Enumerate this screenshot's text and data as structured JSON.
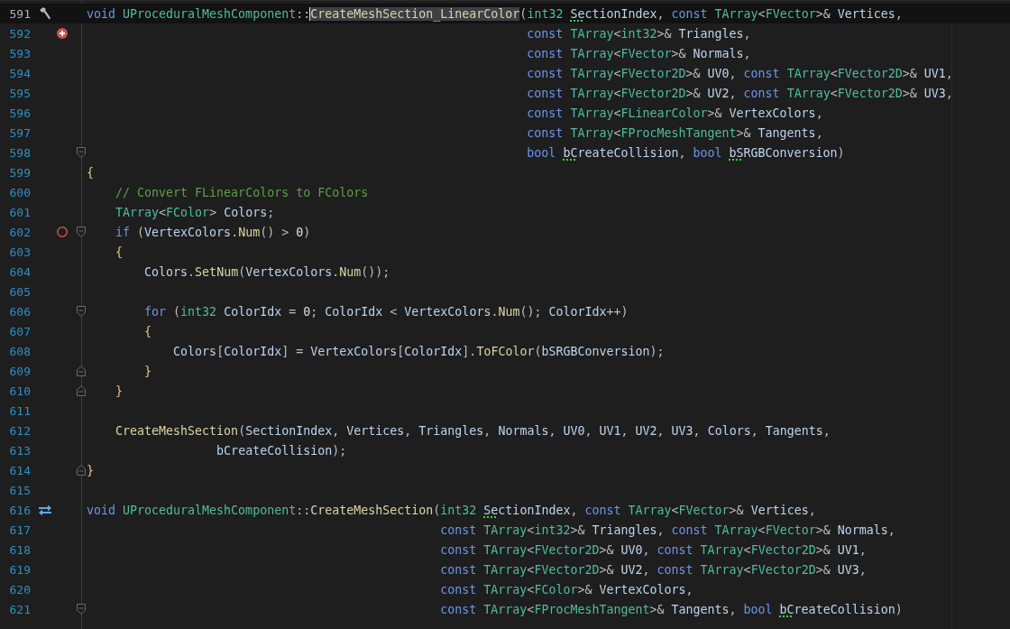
{
  "lines": [
    {
      "number": "591",
      "current": true,
      "kind": "build",
      "tokens": [
        {
          "kind": "keyword",
          "text": "void "
        },
        {
          "kind": "type",
          "text": "UProceduralMeshComponent"
        },
        {
          "kind": "punct",
          "text": "::"
        },
        {
          "kind": "selected",
          "text": "CreateMeshSection_LinearColor"
        },
        {
          "kind": "punct",
          "text": "("
        },
        {
          "kind": "type",
          "text": "int32 "
        },
        {
          "kind": "hint",
          "text": "Se"
        },
        {
          "kind": "variable",
          "text": "ctionIndex"
        },
        {
          "kind": "punct",
          "text": ", "
        },
        {
          "kind": "keyword",
          "text": "const "
        },
        {
          "kind": "type",
          "text": "TArray"
        },
        {
          "kind": "punct",
          "text": "<"
        },
        {
          "kind": "type",
          "text": "FVector"
        },
        {
          "kind": "punct",
          "text": ">& "
        },
        {
          "kind": "variable",
          "text": "Vertices"
        },
        {
          "kind": "punct",
          "text": ","
        }
      ]
    },
    {
      "number": "592",
      "current": false,
      "kind": "add",
      "tokens": [
        {
          "kind": "keyword",
          "text": "                                                             const "
        },
        {
          "kind": "type",
          "text": "TArray"
        },
        {
          "kind": "punct",
          "text": "<"
        },
        {
          "kind": "type",
          "text": "int32"
        },
        {
          "kind": "punct",
          "text": ">& "
        },
        {
          "kind": "variable",
          "text": "Triangles"
        },
        {
          "kind": "punct",
          "text": ","
        }
      ]
    },
    {
      "number": "593",
      "current": false,
      "kind": "plain",
      "tokens": [
        {
          "kind": "keyword",
          "text": "                                                             const "
        },
        {
          "kind": "type",
          "text": "TArray"
        },
        {
          "kind": "punct",
          "text": "<"
        },
        {
          "kind": "type",
          "text": "FVector"
        },
        {
          "kind": "punct",
          "text": ">& "
        },
        {
          "kind": "variable",
          "text": "Normals"
        },
        {
          "kind": "punct",
          "text": ","
        }
      ]
    },
    {
      "number": "594",
      "current": false,
      "kind": "plain",
      "tokens": [
        {
          "kind": "keyword",
          "text": "                                                             const "
        },
        {
          "kind": "type",
          "text": "TArray"
        },
        {
          "kind": "punct",
          "text": "<"
        },
        {
          "kind": "type",
          "text": "FVector2D"
        },
        {
          "kind": "punct",
          "text": ">& "
        },
        {
          "kind": "variable",
          "text": "UV0"
        },
        {
          "kind": "punct",
          "text": ", "
        },
        {
          "kind": "keyword",
          "text": "const "
        },
        {
          "kind": "type",
          "text": "TArray"
        },
        {
          "kind": "punct",
          "text": "<"
        },
        {
          "kind": "type",
          "text": "FVector2D"
        },
        {
          "kind": "punct",
          "text": ">& "
        },
        {
          "kind": "variable",
          "text": "UV1"
        },
        {
          "kind": "punct",
          "text": ","
        }
      ]
    },
    {
      "number": "595",
      "current": false,
      "kind": "plain",
      "tokens": [
        {
          "kind": "keyword",
          "text": "                                                             const "
        },
        {
          "kind": "type",
          "text": "TArray"
        },
        {
          "kind": "punct",
          "text": "<"
        },
        {
          "kind": "type",
          "text": "FVector2D"
        },
        {
          "kind": "punct",
          "text": ">& "
        },
        {
          "kind": "variable",
          "text": "UV2"
        },
        {
          "kind": "punct",
          "text": ", "
        },
        {
          "kind": "keyword",
          "text": "const "
        },
        {
          "kind": "type",
          "text": "TArray"
        },
        {
          "kind": "punct",
          "text": "<"
        },
        {
          "kind": "type",
          "text": "FVector2D"
        },
        {
          "kind": "punct",
          "text": ">& "
        },
        {
          "kind": "variable",
          "text": "UV3"
        },
        {
          "kind": "punct",
          "text": ","
        }
      ]
    },
    {
      "number": "596",
      "current": false,
      "kind": "plain",
      "tokens": [
        {
          "kind": "keyword",
          "text": "                                                             const "
        },
        {
          "kind": "type",
          "text": "TArray"
        },
        {
          "kind": "punct",
          "text": "<"
        },
        {
          "kind": "type",
          "text": "FLinearColor"
        },
        {
          "kind": "punct",
          "text": ">& "
        },
        {
          "kind": "variable",
          "text": "VertexColors"
        },
        {
          "kind": "punct",
          "text": ","
        }
      ]
    },
    {
      "number": "597",
      "current": false,
      "kind": "plain",
      "tokens": [
        {
          "kind": "keyword",
          "text": "                                                             const "
        },
        {
          "kind": "type",
          "text": "TArray"
        },
        {
          "kind": "punct",
          "text": "<"
        },
        {
          "kind": "type",
          "text": "FProcMeshTangent"
        },
        {
          "kind": "punct",
          "text": ">& "
        },
        {
          "kind": "variable",
          "text": "Tangents"
        },
        {
          "kind": "punct",
          "text": ","
        }
      ]
    },
    {
      "number": "598",
      "current": false,
      "kind": "plain",
      "fold": {
        "kind": "start"
      },
      "tokens": [
        {
          "kind": "keyword",
          "text": "                                                             bool "
        },
        {
          "kind": "hint",
          "text": "bC"
        },
        {
          "kind": "variable",
          "text": "reateCollision"
        },
        {
          "kind": "punct",
          "text": ", "
        },
        {
          "kind": "keyword",
          "text": "bool "
        },
        {
          "kind": "hint",
          "text": "bS"
        },
        {
          "kind": "variable",
          "text": "RGBConversion"
        },
        {
          "kind": "punct",
          "text": ")"
        }
      ]
    },
    {
      "number": "599",
      "current": false,
      "kind": "plain",
      "tokens": [
        {
          "kind": "brace",
          "text": "{"
        }
      ]
    },
    {
      "number": "600",
      "current": false,
      "kind": "plain",
      "tokens": [
        {
          "kind": "comment",
          "text": "    // Convert FLinearColors to FColors"
        }
      ]
    },
    {
      "number": "601",
      "current": false,
      "kind": "plain",
      "tokens": [
        {
          "kind": "type",
          "text": "    TArray"
        },
        {
          "kind": "punct",
          "text": "<"
        },
        {
          "kind": "type",
          "text": "FColor"
        },
        {
          "kind": "punct",
          "text": "> "
        },
        {
          "kind": "variable",
          "text": "Colors"
        },
        {
          "kind": "punct",
          "text": ";"
        }
      ]
    },
    {
      "number": "602",
      "current": false,
      "kind": "breakpoint",
      "fold": {
        "kind": "start"
      },
      "tokens": [
        {
          "kind": "keyword",
          "text": "    if"
        },
        {
          "kind": "punct",
          "text": " ("
        },
        {
          "kind": "variable",
          "text": "VertexColors"
        },
        {
          "kind": "punct",
          "text": "."
        },
        {
          "kind": "function",
          "text": "Num"
        },
        {
          "kind": "punct",
          "text": "() > "
        },
        {
          "kind": "number",
          "text": "0"
        },
        {
          "kind": "punct",
          "text": ")"
        }
      ]
    },
    {
      "number": "603",
      "current": false,
      "kind": "plain",
      "tokens": [
        {
          "kind": "brace",
          "text": "    {"
        }
      ]
    },
    {
      "number": "604",
      "current": false,
      "kind": "plain",
      "tokens": [
        {
          "kind": "variable",
          "text": "        Colors"
        },
        {
          "kind": "punct",
          "text": "."
        },
        {
          "kind": "function",
          "text": "SetNum"
        },
        {
          "kind": "punct",
          "text": "("
        },
        {
          "kind": "variable",
          "text": "VertexColors"
        },
        {
          "kind": "punct",
          "text": "."
        },
        {
          "kind": "function",
          "text": "Num"
        },
        {
          "kind": "punct",
          "text": "());"
        }
      ]
    },
    {
      "number": "605",
      "current": false,
      "kind": "plain"
    },
    {
      "number": "606",
      "current": false,
      "kind": "plain",
      "fold": {
        "kind": "start"
      },
      "tokens": [
        {
          "kind": "keyword",
          "text": "        for"
        },
        {
          "kind": "punct",
          "text": " ("
        },
        {
          "kind": "type",
          "text": "int32 "
        },
        {
          "kind": "variable",
          "text": "ColorIdx"
        },
        {
          "kind": "punct",
          "text": " = "
        },
        {
          "kind": "number",
          "text": "0"
        },
        {
          "kind": "punct",
          "text": "; "
        },
        {
          "kind": "variable",
          "text": "ColorIdx"
        },
        {
          "kind": "punct",
          "text": " < "
        },
        {
          "kind": "variable",
          "text": "VertexColors"
        },
        {
          "kind": "punct",
          "text": "."
        },
        {
          "kind": "function",
          "text": "Num"
        },
        {
          "kind": "punct",
          "text": "(); "
        },
        {
          "kind": "variable",
          "text": "ColorIdx"
        },
        {
          "kind": "punct",
          "text": "++)"
        }
      ]
    },
    {
      "number": "607",
      "current": false,
      "kind": "plain",
      "tokens": [
        {
          "kind": "brace",
          "text": "        {"
        }
      ]
    },
    {
      "number": "608",
      "current": false,
      "kind": "plain",
      "tokens": [
        {
          "kind": "variable",
          "text": "            Colors"
        },
        {
          "kind": "punct",
          "text": "["
        },
        {
          "kind": "variable",
          "text": "ColorIdx"
        },
        {
          "kind": "punct",
          "text": "] = "
        },
        {
          "kind": "variable",
          "text": "VertexColors"
        },
        {
          "kind": "punct",
          "text": "["
        },
        {
          "kind": "variable",
          "text": "ColorIdx"
        },
        {
          "kind": "punct",
          "text": "]."
        },
        {
          "kind": "function",
          "text": "ToFColor"
        },
        {
          "kind": "punct",
          "text": "("
        },
        {
          "kind": "variable",
          "text": "bSRGBConversion"
        },
        {
          "kind": "punct",
          "text": ");"
        }
      ]
    },
    {
      "number": "609",
      "current": false,
      "kind": "plain",
      "fold": {
        "kind": "end"
      },
      "tokens": [
        {
          "kind": "brace",
          "text": "        }"
        }
      ]
    },
    {
      "number": "610",
      "current": false,
      "kind": "plain",
      "fold": {
        "kind": "end"
      },
      "tokens": [
        {
          "kind": "brace",
          "text": "    }"
        }
      ]
    },
    {
      "number": "611",
      "current": false,
      "kind": "plain"
    },
    {
      "number": "612",
      "current": false,
      "kind": "plain",
      "tokens": [
        {
          "kind": "function",
          "text": "    CreateMeshSection"
        },
        {
          "kind": "punct",
          "text": "("
        },
        {
          "kind": "variable",
          "text": "SectionIndex"
        },
        {
          "kind": "punct",
          "text": ", "
        },
        {
          "kind": "variable",
          "text": "Vertices"
        },
        {
          "kind": "punct",
          "text": ", "
        },
        {
          "kind": "variable",
          "text": "Triangles"
        },
        {
          "kind": "punct",
          "text": ", "
        },
        {
          "kind": "variable",
          "text": "Normals"
        },
        {
          "kind": "punct",
          "text": ", "
        },
        {
          "kind": "variable",
          "text": "UV0"
        },
        {
          "kind": "punct",
          "text": ", "
        },
        {
          "kind": "variable",
          "text": "UV1"
        },
        {
          "kind": "punct",
          "text": ", "
        },
        {
          "kind": "variable",
          "text": "UV2"
        },
        {
          "kind": "punct",
          "text": ", "
        },
        {
          "kind": "variable",
          "text": "UV3"
        },
        {
          "kind": "punct",
          "text": ", "
        },
        {
          "kind": "variable",
          "text": "Colors"
        },
        {
          "kind": "punct",
          "text": ", "
        },
        {
          "kind": "variable",
          "text": "Tangents"
        },
        {
          "kind": "punct",
          "text": ","
        }
      ]
    },
    {
      "number": "613",
      "current": false,
      "kind": "plain",
      "tokens": [
        {
          "kind": "variable",
          "text": "                  bCreateCollision"
        },
        {
          "kind": "punct",
          "text": ");"
        }
      ]
    },
    {
      "number": "614",
      "current": false,
      "kind": "plain",
      "fold": {
        "kind": "end"
      },
      "tokens": [
        {
          "kind": "brace",
          "text": "}"
        }
      ]
    },
    {
      "number": "615",
      "current": false,
      "kind": "plain"
    },
    {
      "number": "616",
      "current": false,
      "kind": "implements",
      "tokens": [
        {
          "kind": "keyword",
          "text": "void "
        },
        {
          "kind": "type",
          "text": "UProceduralMeshComponent"
        },
        {
          "kind": "punct",
          "text": "::"
        },
        {
          "kind": "function",
          "text": "CreateMeshSection"
        },
        {
          "kind": "punct",
          "text": "("
        },
        {
          "kind": "type",
          "text": "int32 "
        },
        {
          "kind": "hint",
          "text": "Se"
        },
        {
          "kind": "variable",
          "text": "ctionIndex"
        },
        {
          "kind": "punct",
          "text": ", "
        },
        {
          "kind": "keyword",
          "text": "const "
        },
        {
          "kind": "type",
          "text": "TArray"
        },
        {
          "kind": "punct",
          "text": "<"
        },
        {
          "kind": "type",
          "text": "FVector"
        },
        {
          "kind": "punct",
          "text": ">& "
        },
        {
          "kind": "variable",
          "text": "Vertices"
        },
        {
          "kind": "punct",
          "text": ","
        }
      ]
    },
    {
      "number": "617",
      "current": false,
      "kind": "plain",
      "tokens": [
        {
          "kind": "keyword",
          "text": "                                                 const "
        },
        {
          "kind": "type",
          "text": "TArray"
        },
        {
          "kind": "punct",
          "text": "<"
        },
        {
          "kind": "type",
          "text": "int32"
        },
        {
          "kind": "punct",
          "text": ">& "
        },
        {
          "kind": "variable",
          "text": "Triangles"
        },
        {
          "kind": "punct",
          "text": ", "
        },
        {
          "kind": "keyword",
          "text": "const "
        },
        {
          "kind": "type",
          "text": "TArray"
        },
        {
          "kind": "punct",
          "text": "<"
        },
        {
          "kind": "type",
          "text": "FVector"
        },
        {
          "kind": "punct",
          "text": ">& "
        },
        {
          "kind": "variable",
          "text": "Normals"
        },
        {
          "kind": "punct",
          "text": ","
        }
      ]
    },
    {
      "number": "618",
      "current": false,
      "kind": "plain",
      "tokens": [
        {
          "kind": "keyword",
          "text": "                                                 const "
        },
        {
          "kind": "type",
          "text": "TArray"
        },
        {
          "kind": "punct",
          "text": "<"
        },
        {
          "kind": "type",
          "text": "FVector2D"
        },
        {
          "kind": "punct",
          "text": ">& "
        },
        {
          "kind": "variable",
          "text": "UV0"
        },
        {
          "kind": "punct",
          "text": ", "
        },
        {
          "kind": "keyword",
          "text": "const "
        },
        {
          "kind": "type",
          "text": "TArray"
        },
        {
          "kind": "punct",
          "text": "<"
        },
        {
          "kind": "type",
          "text": "FVector2D"
        },
        {
          "kind": "punct",
          "text": ">& "
        },
        {
          "kind": "variable",
          "text": "UV1"
        },
        {
          "kind": "punct",
          "text": ","
        }
      ]
    },
    {
      "number": "619",
      "current": false,
      "kind": "plain",
      "tokens": [
        {
          "kind": "keyword",
          "text": "                                                 const "
        },
        {
          "kind": "type",
          "text": "TArray"
        },
        {
          "kind": "punct",
          "text": "<"
        },
        {
          "kind": "type",
          "text": "FVector2D"
        },
        {
          "kind": "punct",
          "text": ">& "
        },
        {
          "kind": "variable",
          "text": "UV2"
        },
        {
          "kind": "punct",
          "text": ", "
        },
        {
          "kind": "keyword",
          "text": "const "
        },
        {
          "kind": "type",
          "text": "TArray"
        },
        {
          "kind": "punct",
          "text": "<"
        },
        {
          "kind": "type",
          "text": "FVector2D"
        },
        {
          "kind": "punct",
          "text": ">& "
        },
        {
          "kind": "variable",
          "text": "UV3"
        },
        {
          "kind": "punct",
          "text": ","
        }
      ]
    },
    {
      "number": "620",
      "current": false,
      "kind": "plain",
      "tokens": [
        {
          "kind": "keyword",
          "text": "                                                 const "
        },
        {
          "kind": "type",
          "text": "TArray"
        },
        {
          "kind": "punct",
          "text": "<"
        },
        {
          "kind": "type",
          "text": "FColor"
        },
        {
          "kind": "punct",
          "text": ">& "
        },
        {
          "kind": "variable",
          "text": "VertexColors"
        },
        {
          "kind": "punct",
          "text": ","
        }
      ]
    },
    {
      "number": "621",
      "current": false,
      "kind": "plain",
      "fold": {
        "kind": "start"
      },
      "tokens": [
        {
          "kind": "keyword",
          "text": "                                                 const "
        },
        {
          "kind": "type",
          "text": "TArray"
        },
        {
          "kind": "punct",
          "text": "<"
        },
        {
          "kind": "type",
          "text": "FProcMeshTangent"
        },
        {
          "kind": "punct",
          "text": ">& "
        },
        {
          "kind": "variable",
          "text": "Tangents"
        },
        {
          "kind": "punct",
          "text": ", "
        },
        {
          "kind": "keyword",
          "text": "bool "
        },
        {
          "kind": "hint",
          "text": "bC"
        },
        {
          "kind": "variable",
          "text": "reateCollision"
        },
        {
          "kind": "punct",
          "text": ")"
        }
      ]
    }
  ]
}
